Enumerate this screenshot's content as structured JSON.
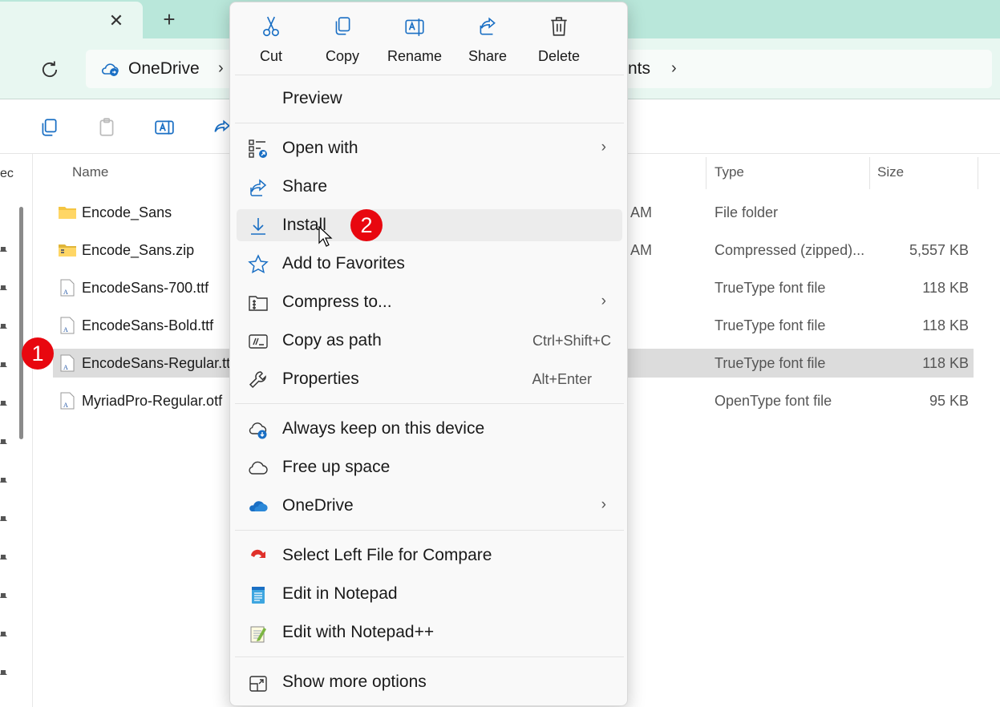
{
  "window": {
    "tab_close_glyph": "✕",
    "tab_new_glyph": "+"
  },
  "address": {
    "crumbs": [
      "OneDrive",
      "nts"
    ],
    "separator": "›"
  },
  "nav": {
    "partial_label": "ec"
  },
  "file_list": {
    "columns": {
      "name": "Name",
      "type": "Type",
      "size": "Size"
    },
    "rows": [
      {
        "name": "Encode_Sans",
        "date": "AM",
        "type": "File folder",
        "size": "",
        "icon": "folder-icon"
      },
      {
        "name": "Encode_Sans.zip",
        "date": "AM",
        "type": "Compressed (zipped)...",
        "size": "5,557 KB",
        "icon": "zip-folder-icon"
      },
      {
        "name": "EncodeSans-700.ttf",
        "date": "",
        "type": "TrueType font file",
        "size": "118 KB",
        "icon": "font-file-icon"
      },
      {
        "name": "EncodeSans-Bold.ttf",
        "date": "",
        "type": "TrueType font file",
        "size": "118 KB",
        "icon": "font-file-icon"
      },
      {
        "name": "EncodeSans-Regular.ttf",
        "date": "",
        "type": "TrueType font file",
        "size": "118 KB",
        "icon": "font-file-icon",
        "selected": true
      },
      {
        "name": "MyriadPro-Regular.otf",
        "date": "",
        "type": "OpenType font file",
        "size": "95 KB",
        "icon": "font-file-icon"
      }
    ]
  },
  "badges": {
    "step1": "1",
    "step2": "2"
  },
  "context_menu": {
    "quick_actions": [
      {
        "label": "Cut",
        "icon": "scissors-icon"
      },
      {
        "label": "Copy",
        "icon": "copy-icon"
      },
      {
        "label": "Rename",
        "icon": "rename-icon"
      },
      {
        "label": "Share",
        "icon": "share-icon"
      },
      {
        "label": "Delete",
        "icon": "trash-icon"
      }
    ],
    "items": {
      "preview": "Preview",
      "open_with": "Open with",
      "share": "Share",
      "install": "Install",
      "add_favorites": "Add to Favorites",
      "compress": "Compress to...",
      "copy_path": "Copy as path",
      "copy_path_shortcut": "Ctrl+Shift+C",
      "properties": "Properties",
      "properties_shortcut": "Alt+Enter",
      "keep_device": "Always keep on this device",
      "free_space": "Free up space",
      "onedrive": "OneDrive",
      "compare": "Select Left File for Compare",
      "notepad": "Edit in Notepad",
      "notepadpp": "Edit with Notepad++",
      "more_options": "Show more options",
      "submenu_chevron": "›"
    }
  },
  "colors": {
    "title_bar": "#b9e7da",
    "badge": "#e8070f",
    "selection": "#dcdcdc",
    "icon_blue": "#1a6fc4"
  }
}
